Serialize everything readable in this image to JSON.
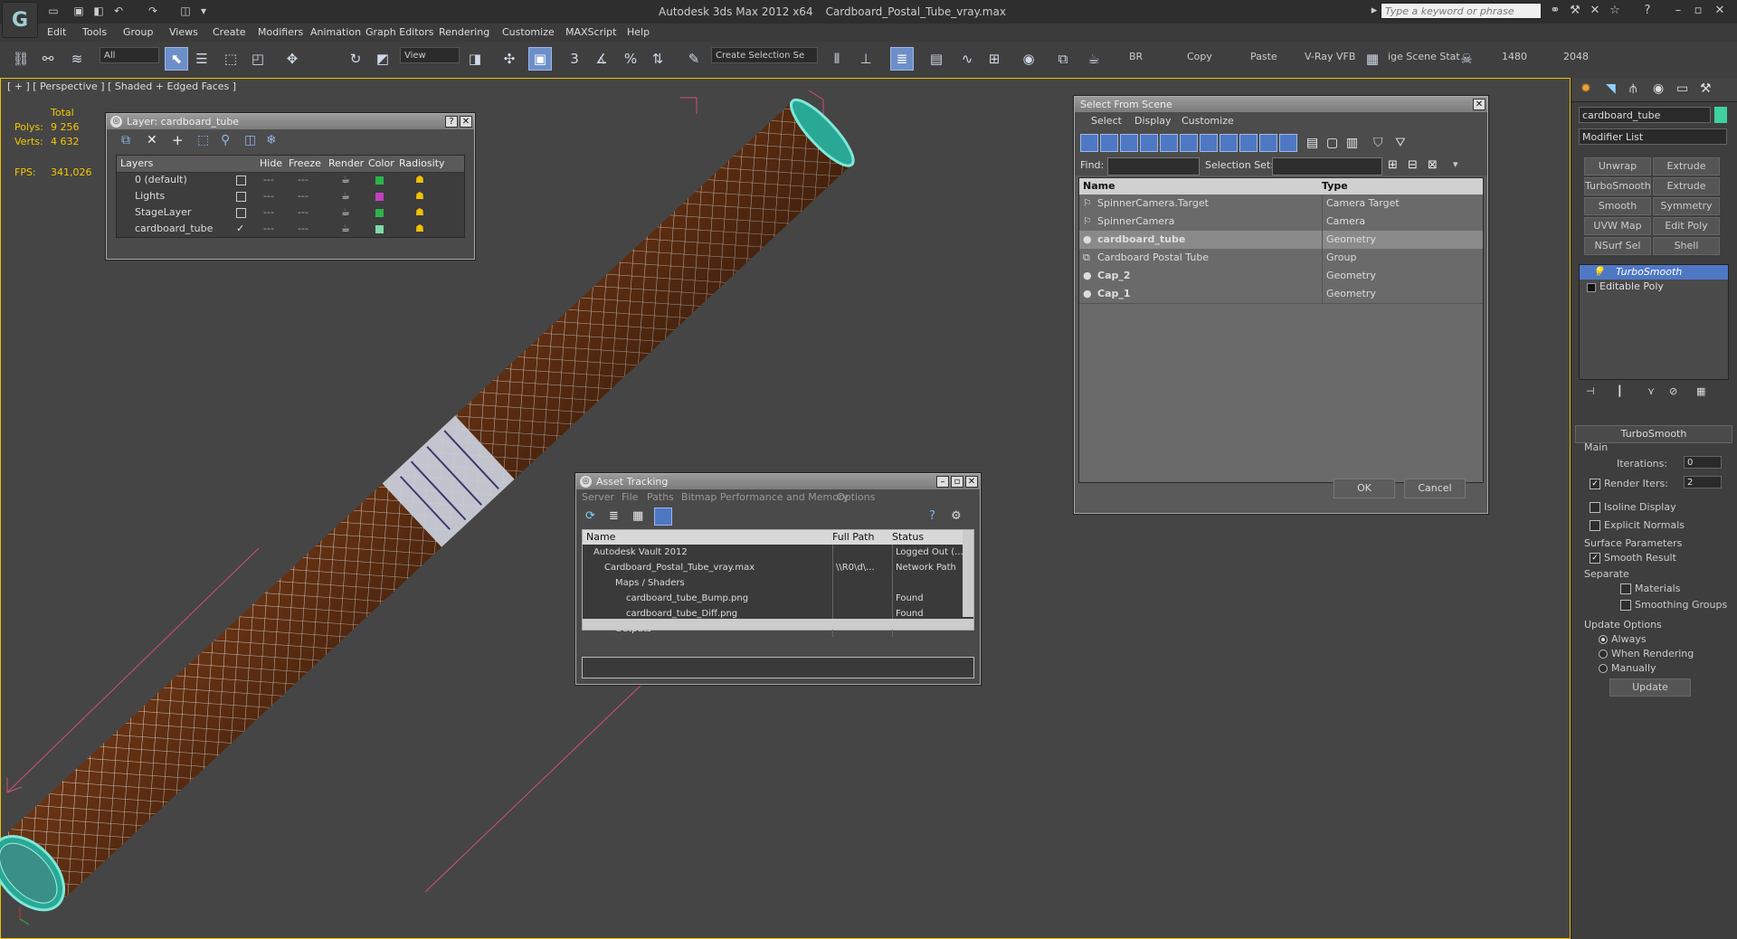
{
  "app": {
    "title": "Autodesk 3ds Max  2012 x64",
    "file": "Cardboard_Postal_Tube_vray.max",
    "logo_letter": "G",
    "search_placeholder": "Type a keyword or phrase"
  },
  "menu": [
    "Edit",
    "Tools",
    "Group",
    "Views",
    "Create",
    "Modifiers",
    "Animation",
    "Graph Editors",
    "Rendering",
    "Customize",
    "MAXScript",
    "Help"
  ],
  "toolbar": {
    "filter": "All",
    "view": "View",
    "snap_label": "3",
    "angle_label": "",
    "percent_label": "%",
    "named_selection": "Create Selection Se",
    "br": "BR",
    "copy": "Copy",
    "paste": "Paste",
    "vray_vfb": "V-Ray VFB",
    "scene_stat": "ige Scene Stat",
    "res1": "1480",
    "res2": "2048"
  },
  "viewport": {
    "label": "[ + ] [ Perspective ] [ Shaded + Edged Faces ]",
    "total_label": "Total",
    "polys_label": "Polys:",
    "polys": "9 256",
    "verts_label": "Verts:",
    "verts": "4 632",
    "fps_label": "FPS:",
    "fps": "341,026"
  },
  "layer_panel": {
    "title": "Layer: cardboard_tube",
    "headers": [
      "Layers",
      "Hide",
      "Freeze",
      "Render",
      "Color",
      "Radiosity"
    ],
    "rows": [
      {
        "name": "0 (default)",
        "color": "#2db34a",
        "active": false
      },
      {
        "name": "Lights",
        "color": "#c040c0",
        "active": false
      },
      {
        "name": "StageLayer",
        "color": "#2db34a",
        "active": false
      },
      {
        "name": "cardboard_tube",
        "color": "#7fd9a8",
        "active": true
      }
    ]
  },
  "select_panel": {
    "title": "Select From Scene",
    "tabs": [
      "Select",
      "Display",
      "Customize"
    ],
    "find_label": "Find:",
    "selset_label": "Selection Set:",
    "col_name": "Name",
    "col_type": "Type",
    "rows": [
      {
        "name": "SpinnerCamera.Target",
        "type": "Camera Target",
        "bold": false,
        "sel": false
      },
      {
        "name": "SpinnerCamera",
        "type": "Camera",
        "bold": false,
        "sel": false
      },
      {
        "name": "cardboard_tube",
        "type": "Geometry",
        "bold": true,
        "sel": true
      },
      {
        "name": "Cardboard Postal Tube",
        "type": "Group",
        "bold": false,
        "sel": false
      },
      {
        "name": "Cap_2",
        "type": "Geometry",
        "bold": true,
        "sel": false
      },
      {
        "name": "Cap_1",
        "type": "Geometry",
        "bold": true,
        "sel": false
      }
    ],
    "ok": "OK",
    "cancel": "Cancel"
  },
  "asset_panel": {
    "title": "Asset Tracking",
    "menu": [
      "Server",
      "File",
      "Paths",
      "Bitmap Performance and Memory",
      "Options"
    ],
    "col_name": "Name",
    "col_path": "Full Path",
    "col_status": "Status",
    "rows": [
      {
        "name": "Autodesk Vault 2012",
        "path": "",
        "status": "Logged Out (...",
        "indent": 1
      },
      {
        "name": "Cardboard_Postal_Tube_vray.max",
        "path": "\\\\R0\\d\\...",
        "status": "Network Path",
        "indent": 2
      },
      {
        "name": "Maps / Shaders",
        "path": "",
        "status": "",
        "indent": 3
      },
      {
        "name": "cardboard_tube_Bump.png",
        "path": "",
        "status": "Found",
        "indent": 4
      },
      {
        "name": "cardboard_tube_Diff.png",
        "path": "",
        "status": "Found",
        "indent": 4
      },
      {
        "name": "Outputs",
        "path": "",
        "status": "",
        "indent": 3
      }
    ]
  },
  "command_panel": {
    "object_name": "cardboard_tube",
    "object_color": "#3fd1a0",
    "modifier_list": "Modifier List",
    "buttons": [
      "Unwrap UVW",
      "Extrude",
      "TurboSmooth",
      "Extrude",
      "Smooth",
      "Symmetry",
      "UVW Map",
      "Edit Poly",
      "NSurf Sel",
      "Shell"
    ],
    "stack": [
      "TurboSmooth",
      "Editable Poly"
    ],
    "rollout_title": "TurboSmooth",
    "main_label": "Main",
    "iterations_label": "Iterations:",
    "iterations": "0",
    "render_iters_label": "Render Iters:",
    "render_iters": "2",
    "isoline": "Isoline Display",
    "explicit": "Explicit Normals",
    "surface_label": "Surface Parameters",
    "smooth_result": "Smooth Result",
    "separate_label": "Separate",
    "materials": "Materials",
    "smoothing_groups": "Smoothing Groups",
    "update_label": "Update Options",
    "always": "Always",
    "when_rendering": "When Rendering",
    "manually": "Manually",
    "update_btn": "Update"
  }
}
